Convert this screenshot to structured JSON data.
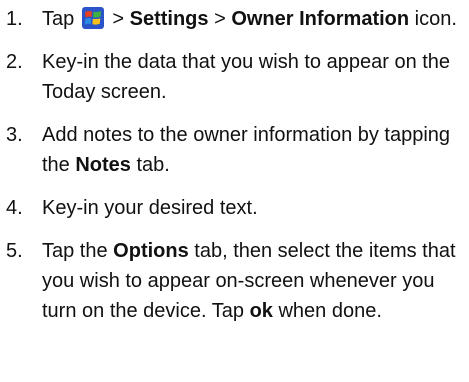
{
  "steps": [
    {
      "number": "1.",
      "before_icon": "Tap ",
      "icon": "windows-start-icon",
      "after_icon": " > ",
      "bold_1": "Settings",
      "sep": " > ",
      "bold_2": "Owner Information",
      "tail": " icon."
    },
    {
      "number": "2.",
      "text": "Key-in the data that you wish to appear on the Today screen."
    },
    {
      "number": "3.",
      "text": "Add notes to the owner information by tapping the ",
      "bold": "Notes",
      "tail": " tab."
    },
    {
      "number": "4.",
      "text": "Key-in your desired text."
    },
    {
      "number": "5.",
      "text": "Tap the ",
      "bold_1": "Options",
      "middle": " tab, then select the items that you wish to appear on-screen whenever you turn on the device. Tap ",
      "bold_2": "ok",
      "tail": " when done."
    }
  ]
}
